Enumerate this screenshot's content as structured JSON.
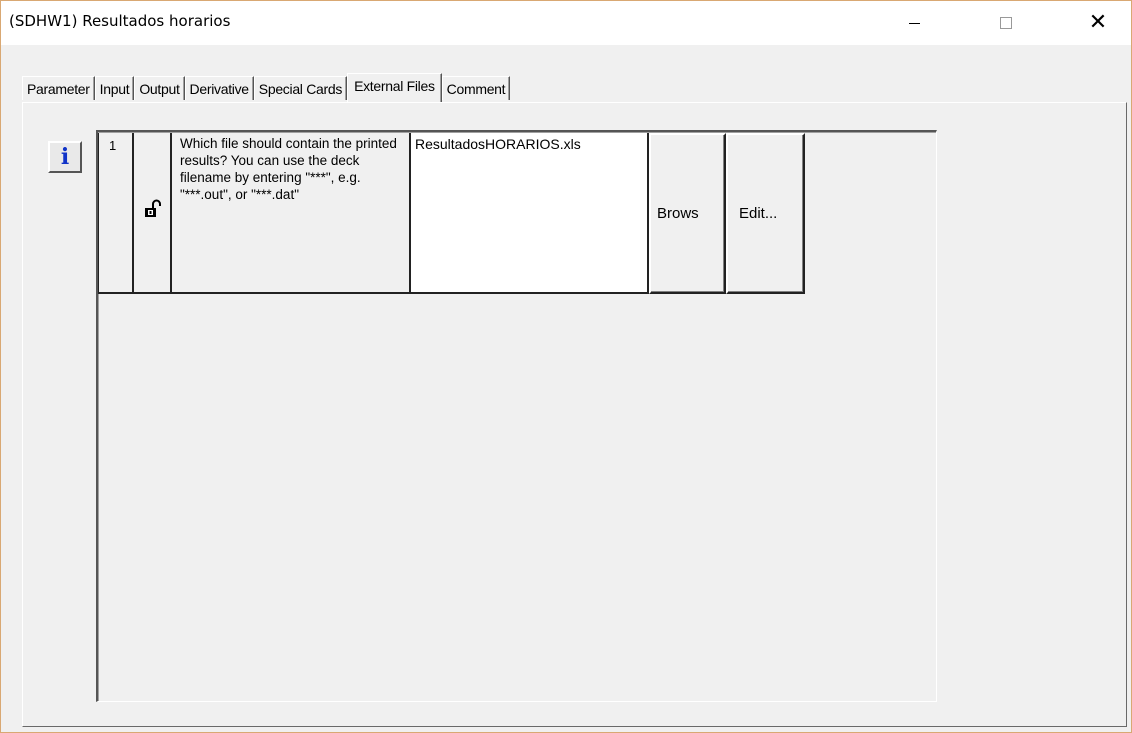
{
  "window": {
    "title": "(SDHW1) Resultados horarios",
    "controls": {
      "minimize": "—",
      "maximize": "☐",
      "close": "✕"
    }
  },
  "tabs": [
    {
      "label": "Parameter",
      "active": false
    },
    {
      "label": "Input",
      "active": false
    },
    {
      "label": "Output",
      "active": false
    },
    {
      "label": "Derivative",
      "active": false
    },
    {
      "label": "Special Cards",
      "active": false
    },
    {
      "label": "External Files",
      "active": true
    },
    {
      "label": "Comment",
      "active": false
    }
  ],
  "info_button": {
    "icon": "info-icon",
    "glyph": "i",
    "color": "#1033c8"
  },
  "rows": [
    {
      "number": "1",
      "lock_icon": "unlocked-padlock-icon",
      "description": "Which file should contain the printed results? You can use the deck filename by entering \"***\", e.g. \"***.out\", or \"***.dat\"",
      "file_value": "ResultadosHORARIOS.xls",
      "browse_label": "Brows",
      "edit_label": "Edit..."
    }
  ]
}
